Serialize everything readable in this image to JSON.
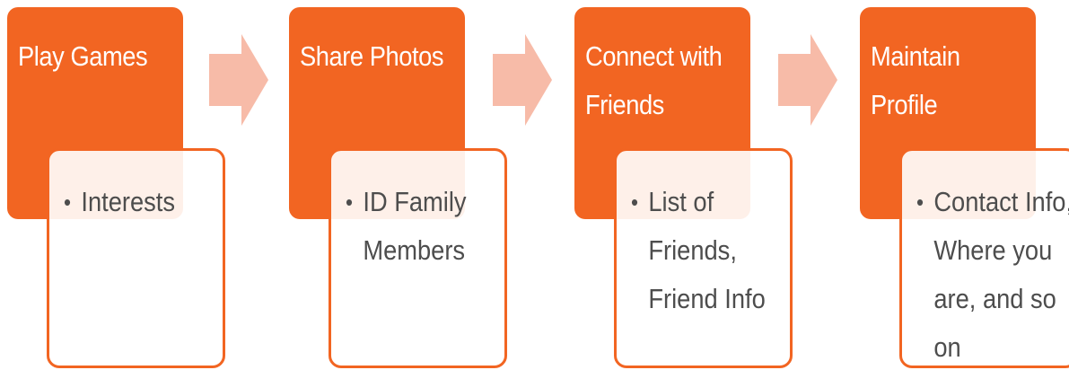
{
  "colors": {
    "header_fill": "#f26522",
    "detail_border": "#f26522",
    "arrow_fill": "#f7bba8",
    "detail_text": "#4d4d4d",
    "header_text": "#ffffff"
  },
  "steps": [
    {
      "title": "Play Games",
      "items": [
        "Interests"
      ]
    },
    {
      "title": "Share Photos",
      "items": [
        "ID Family Members"
      ]
    },
    {
      "title": "Connect with Friends",
      "items": [
        "List of Friends, Friend Info"
      ]
    },
    {
      "title": "Maintain Profile",
      "items": [
        "Contact Info, Where you are, and so on"
      ]
    }
  ],
  "connector_icon": "right-arrow-icon",
  "bullet_char": "•"
}
